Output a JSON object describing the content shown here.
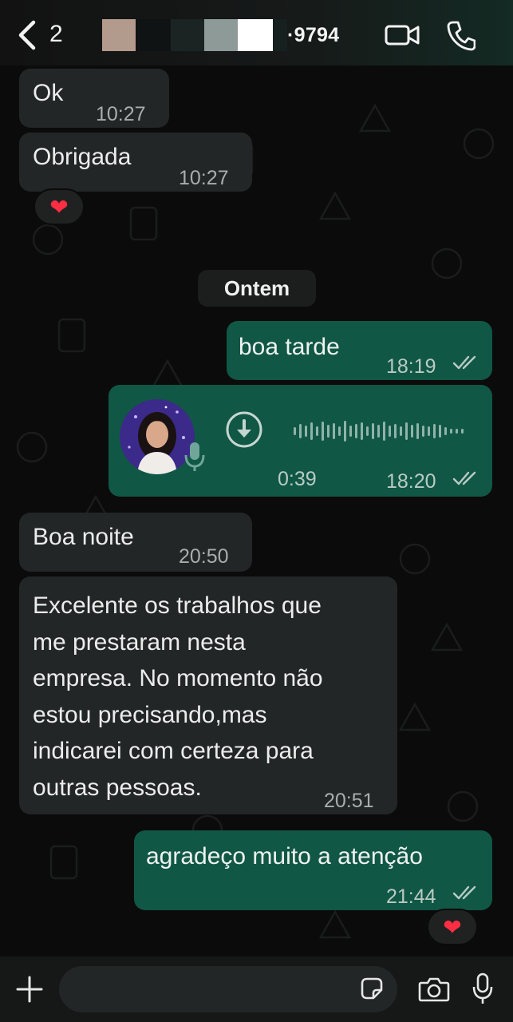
{
  "header": {
    "back_count": "2",
    "contact_suffix": "·9794",
    "icons": {
      "back": "chevron-left-icon",
      "video": "video-camera-icon",
      "call": "phone-icon"
    }
  },
  "messages": [
    {
      "direction": "incoming",
      "text": "Ok",
      "time": "10:27"
    },
    {
      "direction": "incoming",
      "text": "Obrigada",
      "time": "10:27",
      "reaction": "❤"
    },
    {
      "direction": "outgoing",
      "text": "boa tarde",
      "time": "18:19",
      "status": "read"
    },
    {
      "direction": "outgoing",
      "type": "voice",
      "duration": "0:39",
      "time": "18:20",
      "status": "read"
    },
    {
      "direction": "incoming",
      "text": "Boa noite",
      "time": "20:50"
    },
    {
      "direction": "incoming",
      "lines": [
        "Excelente os trabalhos que",
        "me prestaram nesta",
        "empresa. No momento não",
        "estou precisando,mas",
        "indicarei com certeza para",
        "outras pessoas."
      ],
      "time": "20:51"
    },
    {
      "direction": "outgoing",
      "text": "agradeço muito a atenção",
      "time": "21:44",
      "status": "read",
      "reaction": "❤"
    }
  ],
  "day_divider": "Ontem",
  "composer": {
    "text": "",
    "icons": {
      "attach": "plus-icon",
      "sticker": "sticker-icon",
      "camera": "camera-icon",
      "mic": "microphone-icon"
    }
  },
  "colors": {
    "incoming_bubble": "#232626",
    "outgoing_bubble": "#115745",
    "background": "#0b0b0b",
    "reaction_heart": "#ff2e43"
  }
}
